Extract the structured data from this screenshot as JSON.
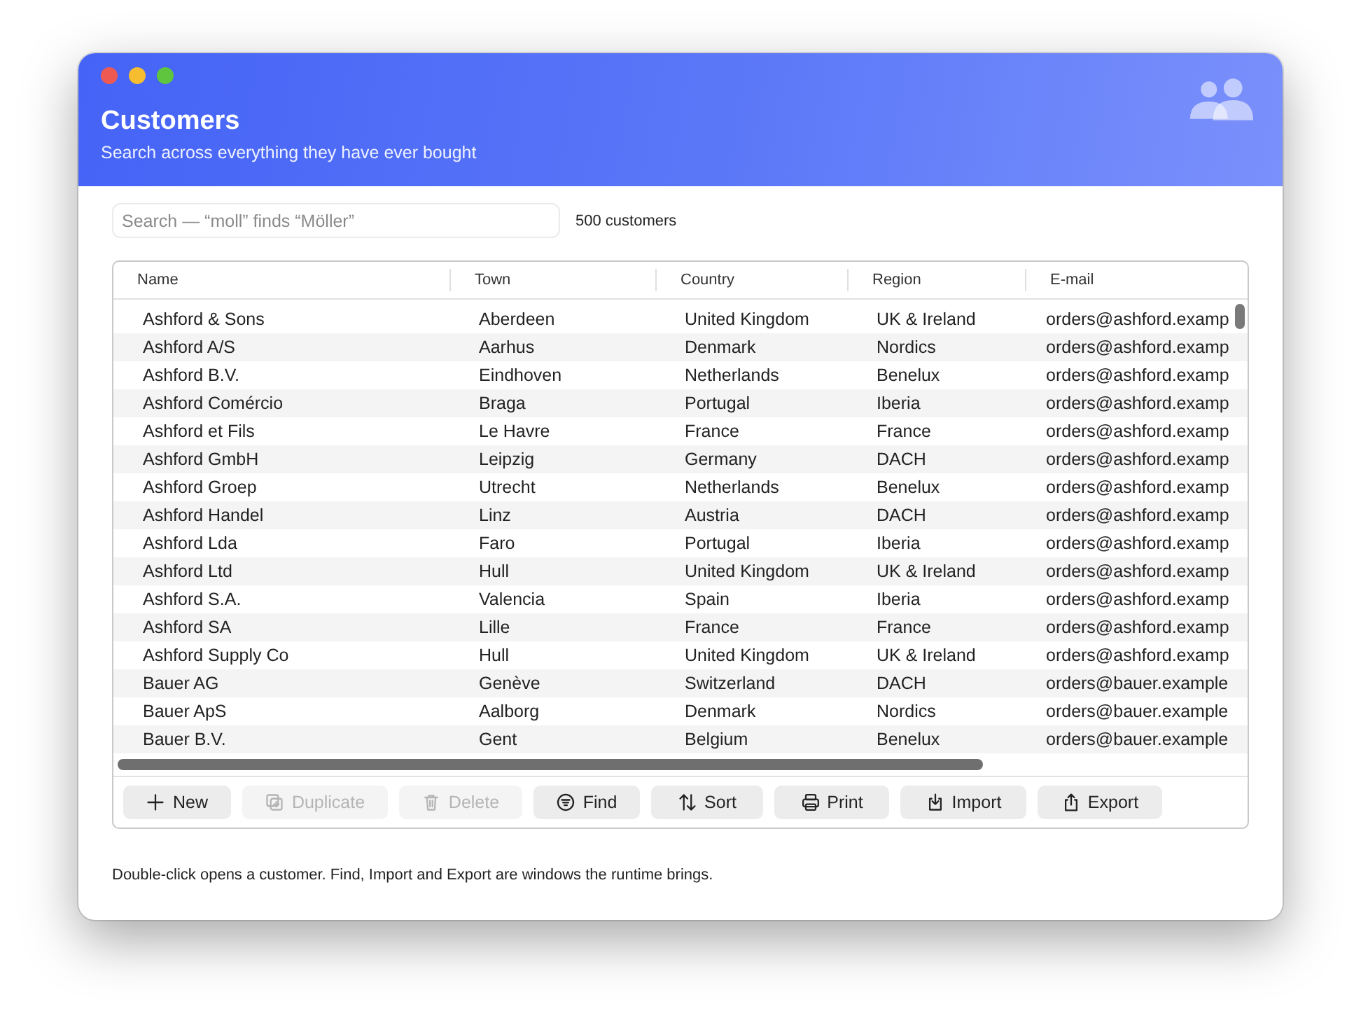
{
  "window": {
    "title": "Customers",
    "subtitle": "Search across everything they have ever bought"
  },
  "search": {
    "placeholder": "Search — “moll” finds “Möller”"
  },
  "count": "500 customers",
  "table": {
    "columns": [
      "Name",
      "Town",
      "Country",
      "Region",
      "E-mail"
    ],
    "rows": [
      [
        "Ashford & Sons",
        "Aberdeen",
        "United Kingdom",
        "UK & Ireland",
        "orders@ashford.examp"
      ],
      [
        "Ashford A/S",
        "Aarhus",
        "Denmark",
        "Nordics",
        "orders@ashford.examp"
      ],
      [
        "Ashford B.V.",
        "Eindhoven",
        "Netherlands",
        "Benelux",
        "orders@ashford.examp"
      ],
      [
        "Ashford Comércio",
        "Braga",
        "Portugal",
        "Iberia",
        "orders@ashford.examp"
      ],
      [
        "Ashford et Fils",
        "Le Havre",
        "France",
        "France",
        "orders@ashford.examp"
      ],
      [
        "Ashford GmbH",
        "Leipzig",
        "Germany",
        "DACH",
        "orders@ashford.examp"
      ],
      [
        "Ashford Groep",
        "Utrecht",
        "Netherlands",
        "Benelux",
        "orders@ashford.examp"
      ],
      [
        "Ashford Handel",
        "Linz",
        "Austria",
        "DACH",
        "orders@ashford.examp"
      ],
      [
        "Ashford Lda",
        "Faro",
        "Portugal",
        "Iberia",
        "orders@ashford.examp"
      ],
      [
        "Ashford Ltd",
        "Hull",
        "United Kingdom",
        "UK & Ireland",
        "orders@ashford.examp"
      ],
      [
        "Ashford S.A.",
        "Valencia",
        "Spain",
        "Iberia",
        "orders@ashford.examp"
      ],
      [
        "Ashford SA",
        "Lille",
        "France",
        "France",
        "orders@ashford.examp"
      ],
      [
        "Ashford Supply Co",
        "Hull",
        "United Kingdom",
        "UK & Ireland",
        "orders@ashford.examp"
      ],
      [
        "Bauer AG",
        "Genève",
        "Switzerland",
        "DACH",
        "orders@bauer.example"
      ],
      [
        "Bauer ApS",
        "Aalborg",
        "Denmark",
        "Nordics",
        "orders@bauer.example"
      ],
      [
        "Bauer B.V.",
        "Gent",
        "Belgium",
        "Benelux",
        "orders@bauer.example"
      ]
    ]
  },
  "buttons": [
    {
      "label": "New",
      "kind": "plus",
      "disabled": false
    },
    {
      "label": "Duplicate",
      "kind": "duplicate",
      "disabled": true
    },
    {
      "label": "Delete",
      "kind": "trash",
      "disabled": true
    },
    {
      "label": "Find",
      "kind": "find",
      "disabled": false
    },
    {
      "label": "Sort",
      "kind": "sort",
      "disabled": false
    },
    {
      "label": "Print",
      "kind": "print",
      "disabled": false
    },
    {
      "label": "Import",
      "kind": "import",
      "disabled": false
    },
    {
      "label": "Export",
      "kind": "export",
      "disabled": false
    }
  ],
  "footer": "Double-click opens a customer. Find, Import and Export are windows the runtime brings."
}
